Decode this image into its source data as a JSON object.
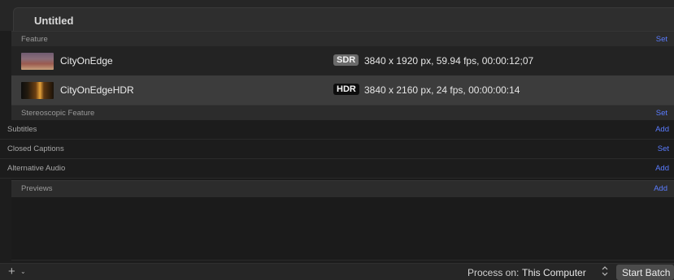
{
  "window": {
    "title": "Untitled"
  },
  "sections": {
    "feature": {
      "label": "Feature",
      "action": "Set"
    },
    "stereoscopic": {
      "label": "Stereoscopic Feature",
      "action": "Set"
    },
    "subtitles": {
      "label": "Subtitles",
      "action": "Add"
    },
    "closed_captions": {
      "label": "Closed Captions",
      "action": "Set"
    },
    "alternative_audio": {
      "label": "Alternative Audio",
      "action": "Add"
    },
    "previews": {
      "label": "Previews",
      "action": "Add"
    }
  },
  "clips": [
    {
      "name": "CityOnEdge",
      "badge": "SDR",
      "info": "3840 x 1920 px, 59.94 fps, 00:00:12;07"
    },
    {
      "name": "CityOnEdgeHDR",
      "badge": "HDR",
      "info": "3840 x 2160 px, 24 fps, 00:00:00:14"
    }
  ],
  "bottombar": {
    "add_icon": "+",
    "menu_icon": "⌄",
    "process_label": "Process on:",
    "process_value": "This Computer",
    "stepper_icon": "⌃⌄",
    "start_button": "Start Batch"
  }
}
